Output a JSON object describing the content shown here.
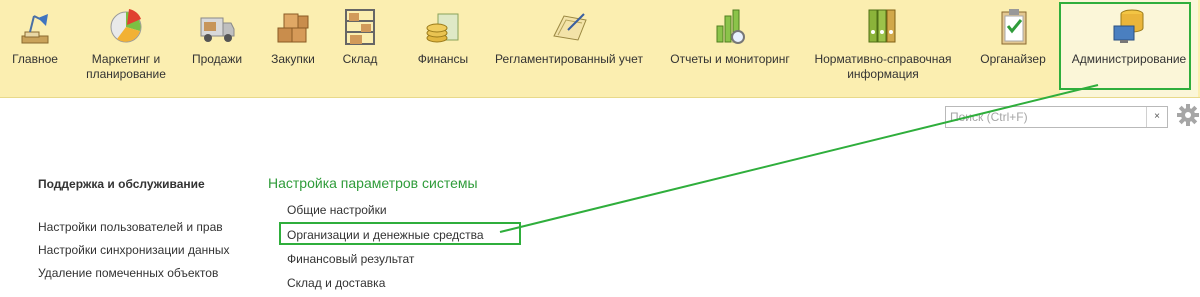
{
  "sections": [
    {
      "label": "Главное",
      "icon": "desk-lamp-icon"
    },
    {
      "label": "Маркетинг и\nпланирование",
      "icon": "pie-chart-icon"
    },
    {
      "label": "Продажи",
      "icon": "delivery-truck-icon"
    },
    {
      "label": "Закупки",
      "icon": "boxes-icon"
    },
    {
      "label": "Склад",
      "icon": "warehouse-shelf-icon"
    },
    {
      "label": "Финансы",
      "icon": "coins-icon"
    },
    {
      "label": "Регламентированный учет",
      "icon": "ledger-icon"
    },
    {
      "label": "Отчеты и мониторинг",
      "icon": "bar-chart-icon"
    },
    {
      "label": "Нормативно-справочная\nинформация",
      "icon": "binders-icon"
    },
    {
      "label": "Органайзер",
      "icon": "clipboard-icon"
    },
    {
      "label": "Администрирование",
      "icon": "database-computer-icon"
    }
  ],
  "search": {
    "placeholder": "Поиск (Ctrl+F)",
    "clear": "×"
  },
  "left_panel": {
    "title": "Поддержка и обслуживание",
    "links": [
      "Настройки пользователей и прав",
      "Настройки синхронизации данных",
      "Удаление помеченных объектов"
    ]
  },
  "system_settings": {
    "title": "Настройка параметров системы",
    "links": [
      "Общие настройки",
      "Организации и денежные средства",
      "Финансовый результат",
      "Склад и доставка"
    ]
  },
  "colors": {
    "toolbar_bg": "#fbeeb0",
    "highlight": "#2fae3c",
    "title_green": "#2f9c3a"
  }
}
